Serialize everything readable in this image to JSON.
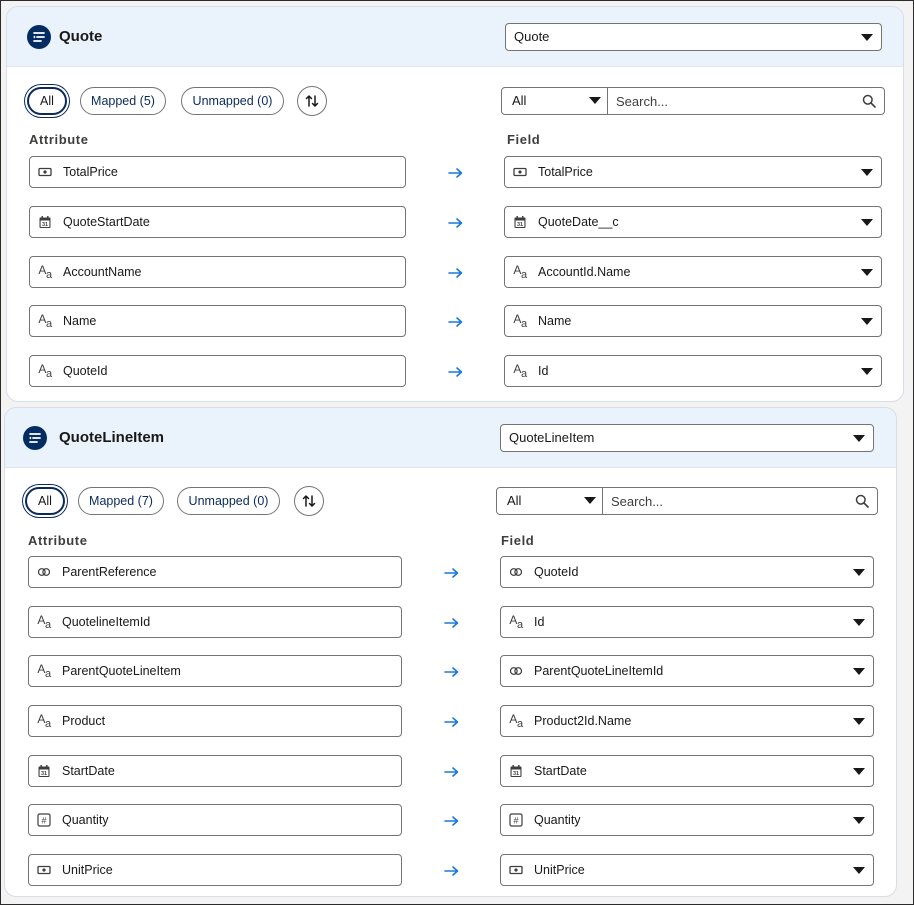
{
  "sections": [
    {
      "title": "Quote",
      "object_select": "Quote",
      "filters": {
        "all": "All",
        "mapped": "Mapped (5)",
        "unmapped": "Unmapped (0)"
      },
      "field_filter": "All",
      "search_placeholder": "Search...",
      "attribute_header": "Attribute",
      "field_header": "Field",
      "rows": [
        {
          "attribute": "TotalPrice",
          "attr_icon": "currency-icon",
          "field": "TotalPrice",
          "field_icon": "currency-icon"
        },
        {
          "attribute": "QuoteStartDate",
          "attr_icon": "calendar-icon",
          "field": "QuoteDate__c",
          "field_icon": "calendar-icon"
        },
        {
          "attribute": "AccountName",
          "attr_icon": "text-icon",
          "field": "AccountId.Name",
          "field_icon": "text-icon"
        },
        {
          "attribute": "Name",
          "attr_icon": "text-icon",
          "field": "Name",
          "field_icon": "text-icon"
        },
        {
          "attribute": "QuoteId",
          "attr_icon": "text-icon",
          "field": "Id",
          "field_icon": "text-icon"
        }
      ]
    },
    {
      "title": "QuoteLineItem",
      "object_select": "QuoteLineItem",
      "filters": {
        "all": "All",
        "mapped": "Mapped (7)",
        "unmapped": "Unmapped (0)"
      },
      "field_filter": "All",
      "search_placeholder": "Search...",
      "attribute_header": "Attribute",
      "field_header": "Field",
      "rows": [
        {
          "attribute": "ParentReference",
          "attr_icon": "link-icon",
          "field": "QuoteId",
          "field_icon": "link-icon"
        },
        {
          "attribute": "QuotelineItemId",
          "attr_icon": "text-icon",
          "field": "Id",
          "field_icon": "text-icon"
        },
        {
          "attribute": "ParentQuoteLineItem",
          "attr_icon": "text-icon",
          "field": "ParentQuoteLineItemId",
          "field_icon": "link-icon"
        },
        {
          "attribute": "Product",
          "attr_icon": "text-icon",
          "field": "Product2Id.Name",
          "field_icon": "text-icon"
        },
        {
          "attribute": "StartDate",
          "attr_icon": "calendar-icon",
          "field": "StartDate",
          "field_icon": "calendar-icon"
        },
        {
          "attribute": "Quantity",
          "attr_icon": "number-icon",
          "field": "Quantity",
          "field_icon": "number-icon"
        },
        {
          "attribute": "UnitPrice",
          "attr_icon": "currency-icon",
          "field": "UnitPrice",
          "field_icon": "currency-icon"
        }
      ]
    }
  ],
  "colors": {
    "accent": "#0b2a5b",
    "arrow": "#1b78d8",
    "header_bg": "#eaf2fc",
    "icon_bg": "#032d60"
  }
}
